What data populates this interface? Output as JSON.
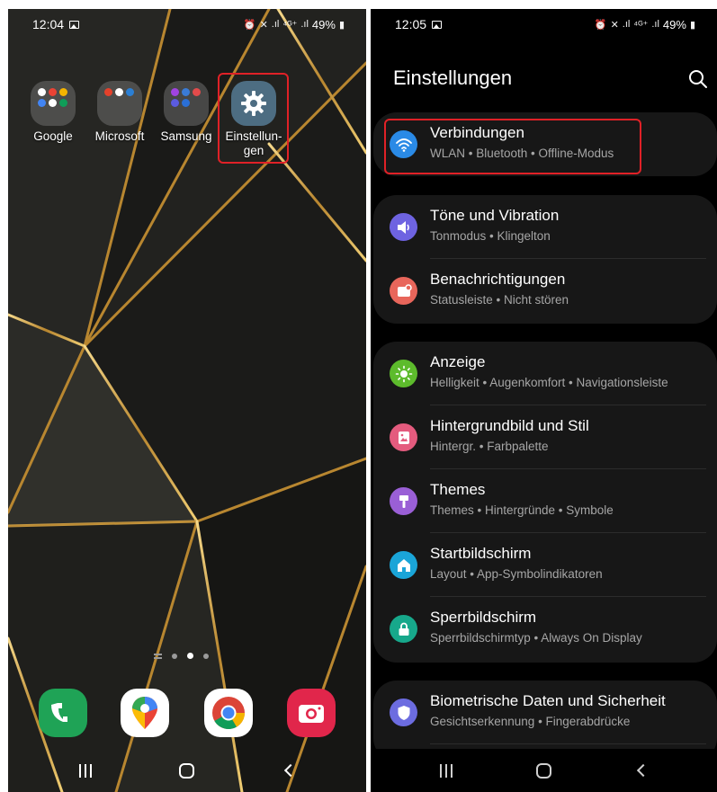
{
  "left_screen": {
    "status": {
      "time": "12:04",
      "right": "⏰ 🔇 .ıl ⁴ᴳ⁺ .ıl 49%",
      "battery": "49%"
    },
    "apps": [
      {
        "label": "Google",
        "icon": "google-folder-icon"
      },
      {
        "label": "Microsoft",
        "icon": "microsoft-folder-icon"
      },
      {
        "label": "Samsung",
        "icon": "samsung-folder-icon"
      },
      {
        "label": "Einstellun-\ngen",
        "label_line1": "Einstellun-",
        "label_line2": "gen",
        "icon": "settings-gear-icon"
      }
    ],
    "dock": [
      {
        "name": "phone",
        "icon": "phone-icon",
        "color": "#1fa356"
      },
      {
        "name": "maps",
        "icon": "maps-pin-icon",
        "color": "#ffffff"
      },
      {
        "name": "chrome",
        "icon": "chrome-icon",
        "color": "#ffffff"
      },
      {
        "name": "camera",
        "icon": "camera-icon",
        "color": "#e1264b"
      }
    ],
    "page_indicator": {
      "pages": 3,
      "active_page": 2
    }
  },
  "right_screen": {
    "status": {
      "time": "12:05",
      "right": "⏰ 🔇 .ıl ⁴ᴳ⁺ .ıl 49%"
    },
    "title": "Einstellungen",
    "groups": [
      {
        "items": [
          {
            "title": "Verbindungen",
            "subtitle": "WLAN • Bluetooth • Offline-Modus",
            "icon": "wifi-icon",
            "color": "#2a8ae6"
          }
        ]
      },
      {
        "items": [
          {
            "title": "Töne und Vibration",
            "subtitle": "Tonmodus • Klingelton",
            "icon": "speaker-icon",
            "color": "#6e63e1"
          },
          {
            "title": "Benachrichtigungen",
            "subtitle": "Statusleiste • Nicht stören",
            "icon": "notification-icon",
            "color": "#e8665b"
          }
        ]
      },
      {
        "items": [
          {
            "title": "Anzeige",
            "subtitle": "Helligkeit • Augenkomfort • Navigationsleiste",
            "icon": "sun-icon",
            "color": "#5dbb2c"
          },
          {
            "title": "Hintergrundbild und Stil",
            "subtitle": "Hintergr. • Farbpalette",
            "icon": "wallpaper-icon",
            "color": "#e45b7e"
          },
          {
            "title": "Themes",
            "subtitle": "Themes • Hintergründe • Symbole",
            "icon": "brush-icon",
            "color": "#9a5fd6"
          },
          {
            "title": "Startbildschirm",
            "subtitle": "Layout • App-Symbolindikatoren",
            "icon": "home-icon",
            "color": "#1aa5d8"
          },
          {
            "title": "Sperrbildschirm",
            "subtitle": "Sperrbildschirmtyp • Always On Display",
            "icon": "lock-icon",
            "color": "#17a88b"
          }
        ]
      },
      {
        "items": [
          {
            "title": "Biometrische Daten und Sicherheit",
            "subtitle": "Gesichtserkennung • Fingerabdrücke",
            "icon": "shield-icon",
            "color": "#6c6ce0"
          }
        ]
      }
    ]
  },
  "colors": {
    "highlight": "#e02127",
    "card": "#171717",
    "subtitle": "#a6a6a6"
  }
}
